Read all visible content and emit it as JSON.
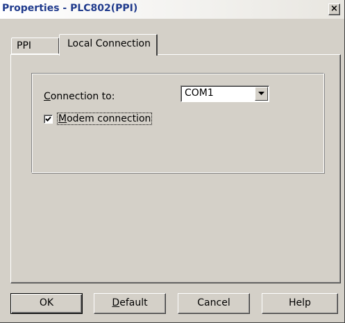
{
  "window": {
    "title": "Properties - PLC802(PPI)",
    "close_glyph": "×"
  },
  "tabs": [
    {
      "label": "PPI",
      "selected": false
    },
    {
      "label": "Local Connection",
      "selected": true
    }
  ],
  "local_connection": {
    "connection_label_mnemonic": "C",
    "connection_label_rest": "onnection to:",
    "connection_value": "COM1",
    "modem_checked": true,
    "modem_label_mnemonic": "M",
    "modem_label_rest": "odem connection"
  },
  "buttons": {
    "ok": "OK",
    "default_mnemonic": "D",
    "default_rest": "efault",
    "cancel": "Cancel",
    "help": "Help"
  },
  "colors": {
    "dialog_bg": "#d4d0c8",
    "title_text": "#1f3a8c"
  },
  "icons": {
    "close": "close-icon",
    "dropdown": "chevron-down-icon",
    "check": "checkmark-icon"
  }
}
